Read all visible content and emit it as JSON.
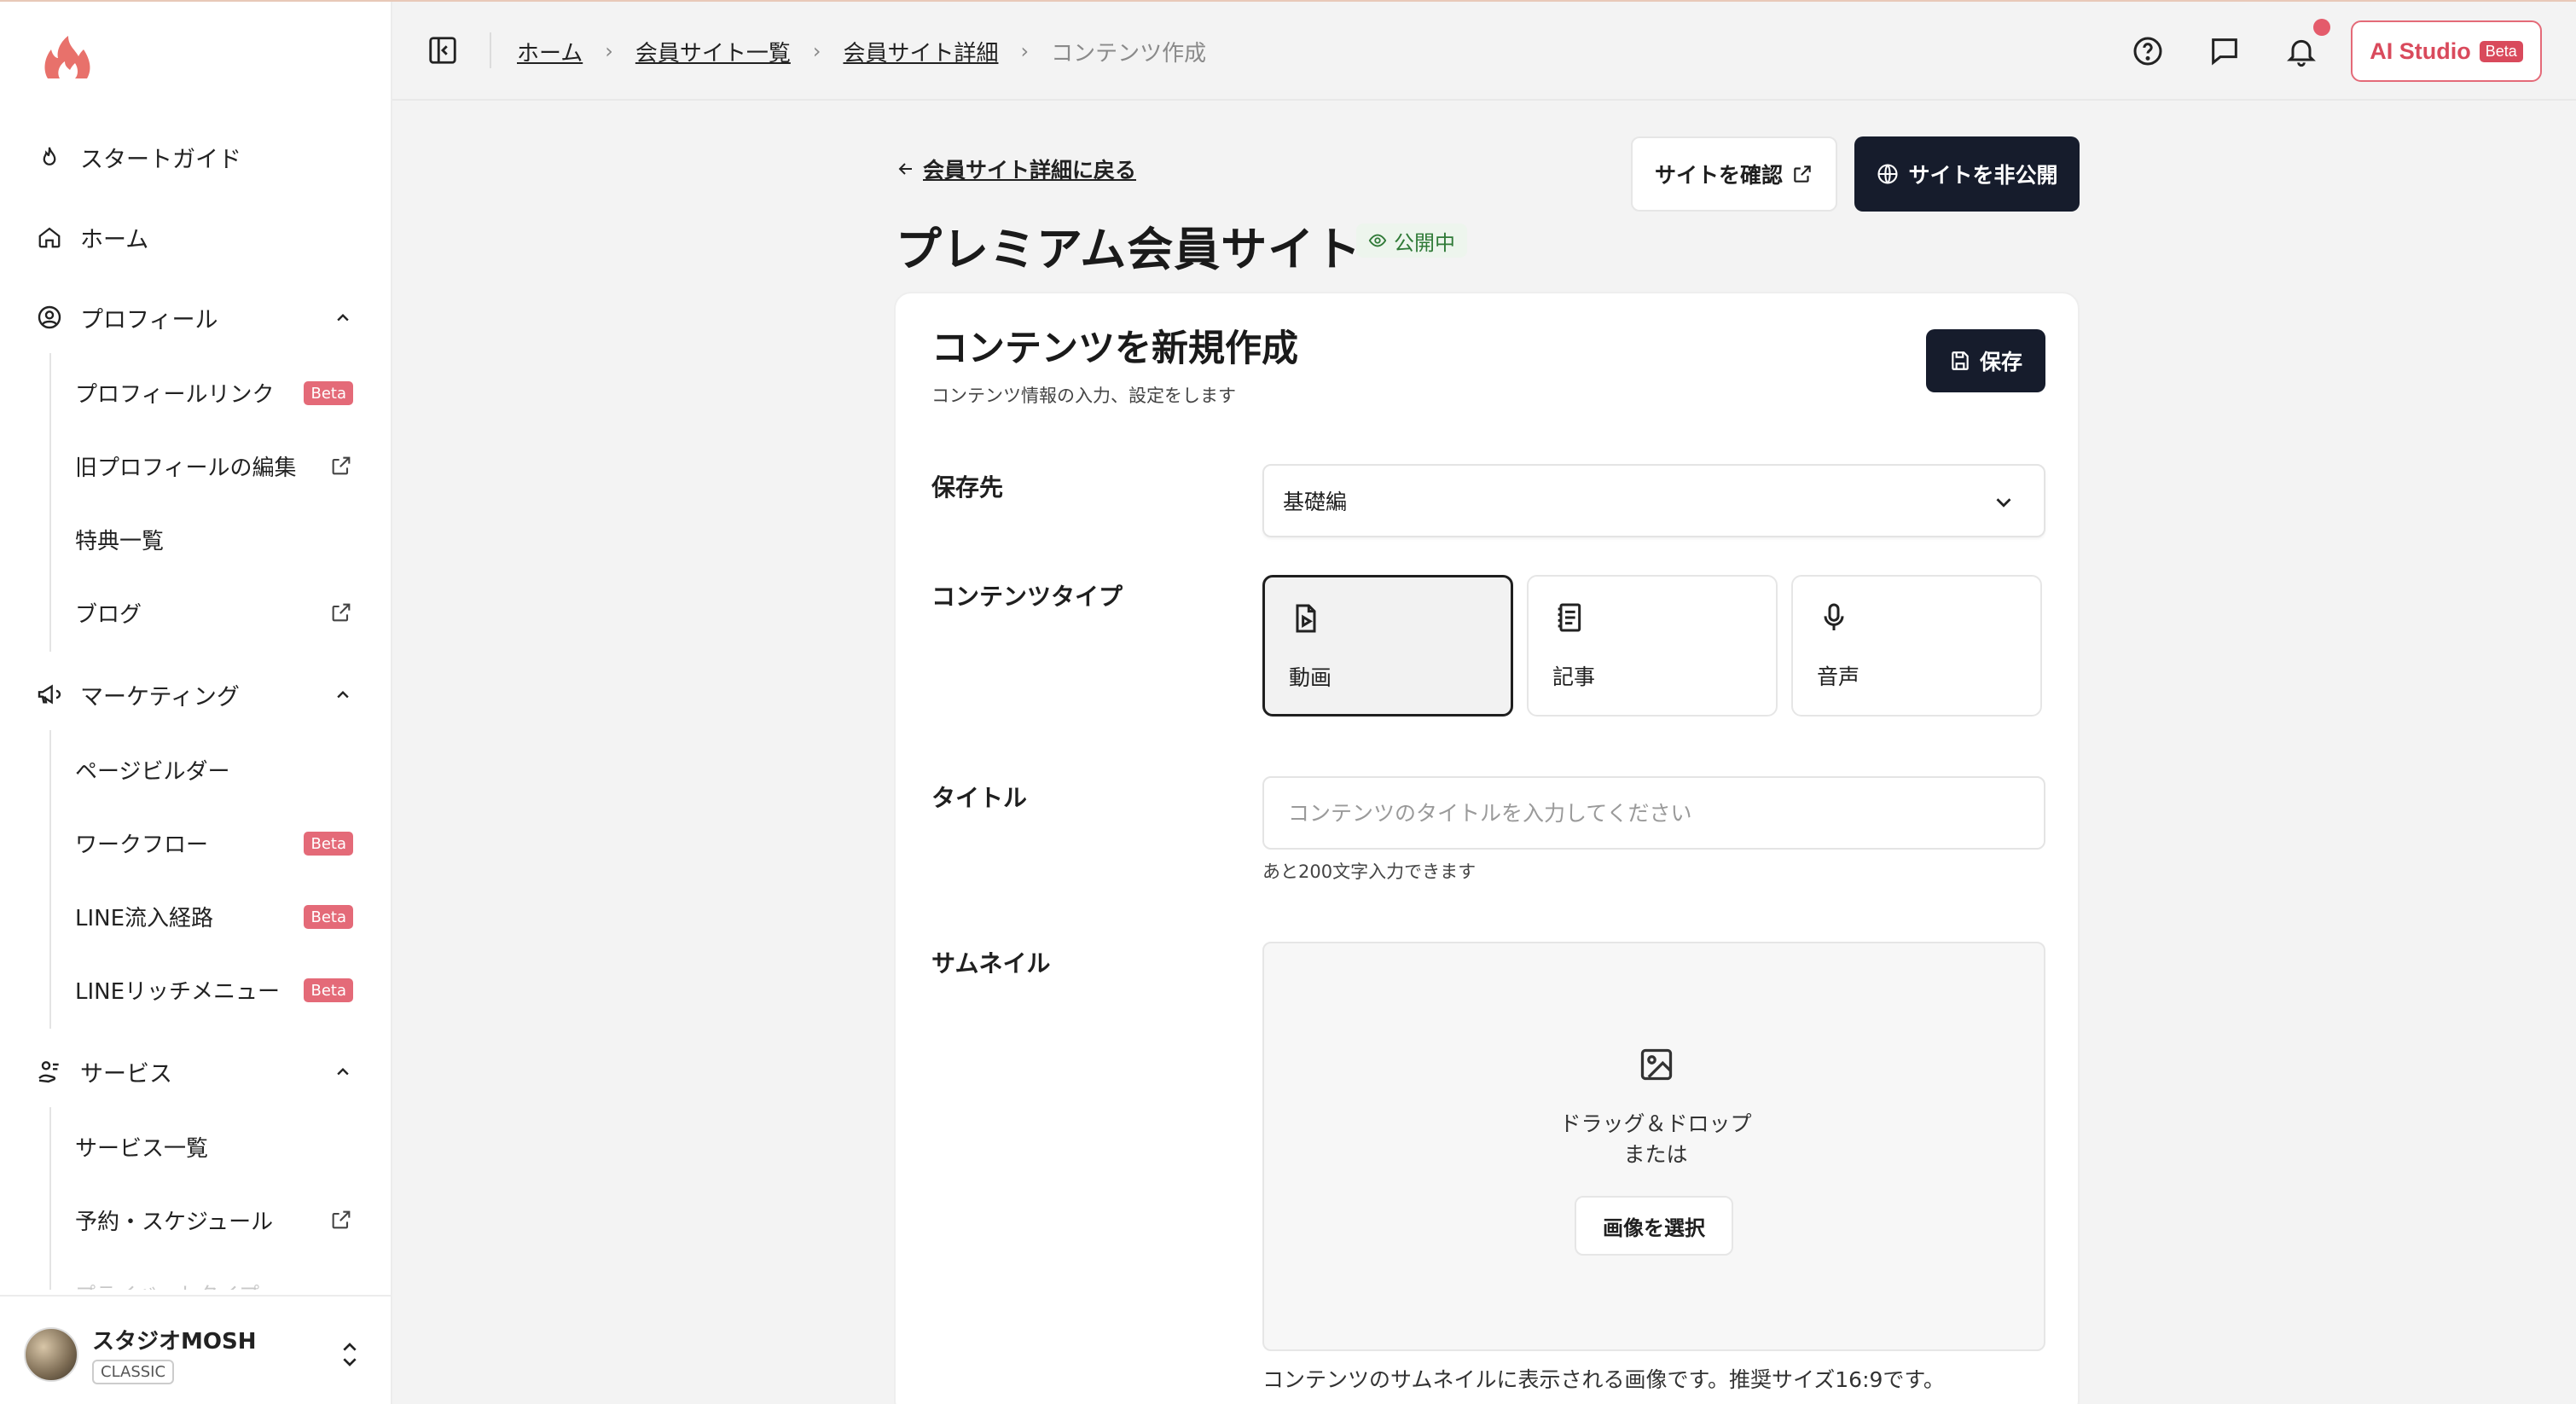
{
  "sidebar": {
    "items": [
      {
        "label": "スタートガイド"
      },
      {
        "label": "ホーム"
      },
      {
        "label": "プロフィール"
      },
      {
        "label": "マーケティング"
      },
      {
        "label": "サービス"
      }
    ],
    "profile_sub": [
      {
        "label": "プロフィールリンク",
        "badge": "Beta"
      },
      {
        "label": "旧プロフィールの編集"
      },
      {
        "label": "特典一覧"
      },
      {
        "label": "ブログ"
      }
    ],
    "marketing_sub": [
      {
        "label": "ページビルダー"
      },
      {
        "label": "ワークフロー",
        "badge": "Beta"
      },
      {
        "label": "LINE流入経路",
        "badge": "Beta"
      },
      {
        "label": "LINEリッチメニュー",
        "badge": "Beta"
      }
    ],
    "service_sub": [
      {
        "label": "サービス一覧"
      },
      {
        "label": "予約・スケジュール"
      }
    ],
    "faded_item": "プライベートタイプ",
    "account": {
      "name": "スタジオMOSH",
      "plan": "CLASSIC"
    }
  },
  "header": {
    "breadcrumbs": [
      "ホーム",
      "会員サイト一覧",
      "会員サイト詳細",
      "コンテンツ作成"
    ],
    "ai_studio": {
      "label": "AI Studio",
      "badge": "Beta"
    }
  },
  "page": {
    "back_label": "会員サイト詳細に戻る",
    "title": "プレミアム会員サイト",
    "status": "公開中",
    "view_site_label": "サイトを確認",
    "unpublish_label": "サイトを非公開"
  },
  "form": {
    "title": "コンテンツを新規作成",
    "subtitle": "コンテンツ情報の入力、設定をします",
    "save_label": "保存",
    "destination": {
      "label": "保存先",
      "value": "基礎編"
    },
    "content_type": {
      "label": "コンテンツタイプ",
      "options": [
        {
          "label": "動画",
          "icon": "video-file-icon",
          "selected": true
        },
        {
          "label": "記事",
          "icon": "article-icon",
          "selected": false
        },
        {
          "label": "音声",
          "icon": "microphone-icon",
          "selected": false
        }
      ]
    },
    "title_field": {
      "label": "タイトル",
      "value": "",
      "placeholder": "コンテンツのタイトルを入力してください",
      "hint": "あと200文字入力できます"
    },
    "thumbnail": {
      "label": "サムネイル",
      "drop_text": "ドラッグ＆ドロップ",
      "or_text": "または",
      "select_label": "画像を選択",
      "hint": "コンテンツのサムネイルに表示される画像です。推奨サイズ16:9です。"
    }
  },
  "colors": {
    "accent": "#e46a78",
    "dark_button": "#161c2c",
    "status_green": "#2f7a37",
    "notification": "#e45b6b"
  }
}
